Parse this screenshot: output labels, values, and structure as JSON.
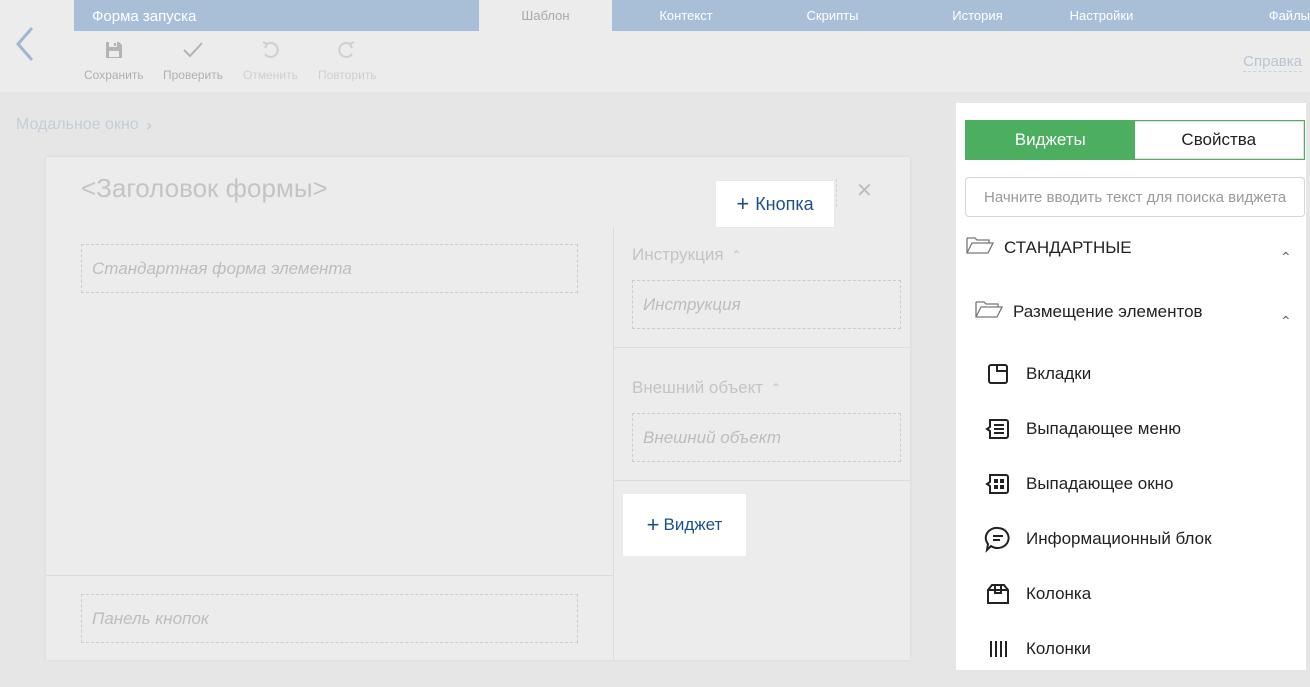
{
  "header": {
    "app_title": "Форма запуска",
    "tabs": [
      {
        "label": "Шаблон",
        "active": true
      },
      {
        "label": "Контекст",
        "active": false
      },
      {
        "label": "Скрипты",
        "active": false
      },
      {
        "label": "История",
        "active": false
      },
      {
        "label": "Настройки",
        "active": false
      },
      {
        "label": "Файлы",
        "active": false
      }
    ]
  },
  "toolbar": {
    "save": {
      "label": "Сохранить",
      "icon": "floppy-disk-icon"
    },
    "check": {
      "label": "Проверить",
      "icon": "checkmark-icon"
    },
    "undo": {
      "label": "Отменить",
      "icon": "undo-icon"
    },
    "redo": {
      "label": "Повторить",
      "icon": "redo-icon"
    },
    "help": "Справка"
  },
  "breadcrumb": {
    "item": "Модальное окно"
  },
  "modal": {
    "title": "<Заголовок формы>",
    "add_button_label": "Кнопка",
    "main_dropzone": "Стандартная форма элемента",
    "instruction_label": "Инструкция",
    "instruction_dropzone": "Инструкция",
    "external_label": "Внешний объект",
    "external_dropzone": "Внешний объект",
    "add_widget_label": "Виджет",
    "buttons_dropzone": "Панель кнопок"
  },
  "panel": {
    "tabs": {
      "widgets": "Виджеты",
      "properties": "Свойства"
    },
    "search_placeholder": "Начните вводить текст для поиска виджета",
    "group_standard": "СТАНДАРТНЫЕ",
    "group_layout": "Размещение элементов",
    "items": [
      {
        "label": "Вкладки",
        "icon": "tabs-icon"
      },
      {
        "label": "Выпадающее меню",
        "icon": "dropdown-menu-icon"
      },
      {
        "label": "Выпадающее окно",
        "icon": "dropdown-window-icon"
      },
      {
        "label": "Информационный блок",
        "icon": "info-block-icon"
      },
      {
        "label": "Колонка",
        "icon": "column-icon"
      },
      {
        "label": "Колонки",
        "icon": "columns-icon"
      }
    ]
  },
  "colors": {
    "accent_green": "#4cae5f",
    "header_blue": "#a9bfd8",
    "link_blue": "#1e4f8c"
  }
}
